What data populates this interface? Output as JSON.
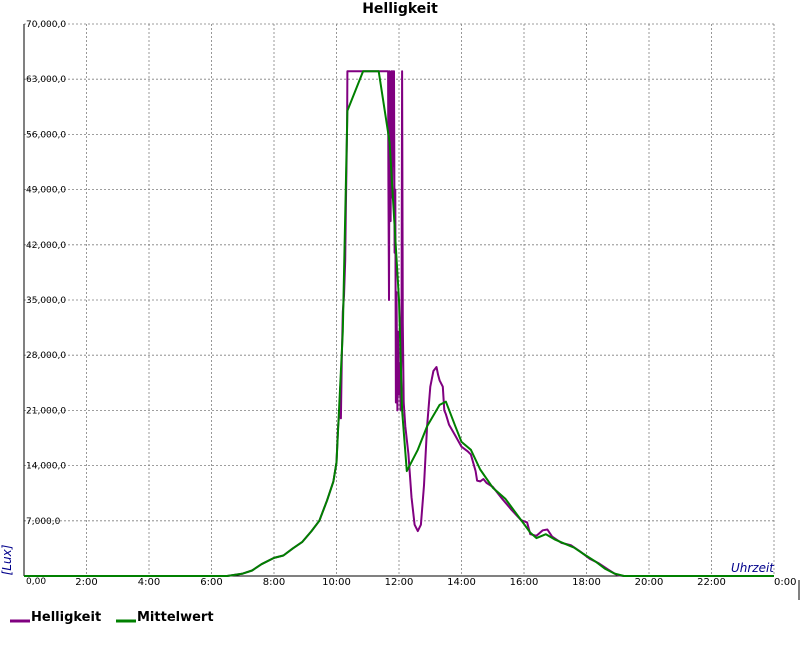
{
  "chart_data": {
    "type": "line",
    "title": "Helligkeit",
    "xlabel": "Uhrzeit",
    "ylabel": "[Lux]",
    "xlim": [
      0,
      24
    ],
    "ylim": [
      0,
      70000
    ],
    "grid": true,
    "legend_position": "bottom-left",
    "y_ticks": [
      {
        "value": 0,
        "label": "0,00"
      },
      {
        "value": 7000,
        "label": "7,000,0"
      },
      {
        "value": 14000,
        "label": "14,000,0"
      },
      {
        "value": 21000,
        "label": "21,000,0"
      },
      {
        "value": 28000,
        "label": "28,000,0"
      },
      {
        "value": 35000,
        "label": "35,000,0"
      },
      {
        "value": 42000,
        "label": "42,000,0"
      },
      {
        "value": 49000,
        "label": "49,000,0"
      },
      {
        "value": 56000,
        "label": "56,000,0"
      },
      {
        "value": 63000,
        "label": "63,000,0"
      },
      {
        "value": 70000,
        "label": "70,000,0"
      }
    ],
    "x_ticks": [
      {
        "value": 2,
        "label": "2:00"
      },
      {
        "value": 4,
        "label": "4:00"
      },
      {
        "value": 6,
        "label": "6:00"
      },
      {
        "value": 8,
        "label": "8:00"
      },
      {
        "value": 10,
        "label": "10:00"
      },
      {
        "value": 12,
        "label": "12:00"
      },
      {
        "value": 14,
        "label": "14:00"
      },
      {
        "value": 16,
        "label": "16:00"
      },
      {
        "value": 18,
        "label": "18:00"
      },
      {
        "value": 20,
        "label": "20:00"
      },
      {
        "value": 22,
        "label": "22:00"
      },
      {
        "value": 24,
        "label": "0:00"
      }
    ],
    "series": [
      {
        "name": "Helligkeit",
        "color": "#800080",
        "points": [
          [
            0,
            0
          ],
          [
            6.5,
            0
          ],
          [
            7.0,
            300
          ],
          [
            7.3,
            700
          ],
          [
            7.6,
            1500
          ],
          [
            8.0,
            2300
          ],
          [
            8.3,
            2600
          ],
          [
            8.6,
            3500
          ],
          [
            8.9,
            4300
          ],
          [
            9.2,
            5700
          ],
          [
            9.45,
            7000
          ],
          [
            9.7,
            9600
          ],
          [
            9.9,
            12000
          ],
          [
            10.0,
            14400
          ],
          [
            10.05,
            19000
          ],
          [
            10.1,
            21000
          ],
          [
            10.12,
            24000
          ],
          [
            10.14,
            20000
          ],
          [
            10.17,
            27500
          ],
          [
            10.2,
            33500
          ],
          [
            10.24,
            35500
          ],
          [
            10.28,
            40000
          ],
          [
            10.3,
            47000
          ],
          [
            10.32,
            52000
          ],
          [
            10.34,
            57000
          ],
          [
            10.35,
            64000
          ],
          [
            11.65,
            64000
          ],
          [
            11.66,
            50000
          ],
          [
            11.68,
            35000
          ],
          [
            11.7,
            64000
          ],
          [
            11.73,
            45000
          ],
          [
            11.76,
            64000
          ],
          [
            11.78,
            48000
          ],
          [
            11.8,
            64000
          ],
          [
            11.82,
            52000
          ],
          [
            11.84,
            64000
          ],
          [
            11.86,
            41000
          ],
          [
            11.88,
            49000
          ],
          [
            11.9,
            22000
          ],
          [
            11.92,
            36000
          ],
          [
            11.95,
            21000
          ],
          [
            11.97,
            31000
          ],
          [
            12.0,
            23000
          ],
          [
            12.03,
            27000
          ],
          [
            12.05,
            21000
          ],
          [
            12.08,
            30000
          ],
          [
            12.1,
            64000
          ],
          [
            12.12,
            32000
          ],
          [
            12.15,
            22000
          ],
          [
            12.2,
            19000
          ],
          [
            12.3,
            15500
          ],
          [
            12.4,
            10000
          ],
          [
            12.5,
            6500
          ],
          [
            12.6,
            5700
          ],
          [
            12.7,
            6500
          ],
          [
            12.8,
            11500
          ],
          [
            12.9,
            19000
          ],
          [
            13.0,
            24000
          ],
          [
            13.1,
            26000
          ],
          [
            13.2,
            26500
          ],
          [
            13.25,
            25500
          ],
          [
            13.3,
            24800
          ],
          [
            13.4,
            24000
          ],
          [
            13.45,
            21000
          ],
          [
            13.5,
            20500
          ],
          [
            13.6,
            19200
          ],
          [
            13.8,
            17800
          ],
          [
            14.0,
            16400
          ],
          [
            14.2,
            15800
          ],
          [
            14.3,
            15400
          ],
          [
            14.45,
            13300
          ],
          [
            14.5,
            12100
          ],
          [
            14.6,
            12000
          ],
          [
            14.7,
            12300
          ],
          [
            14.8,
            11800
          ],
          [
            15.0,
            11300
          ],
          [
            15.3,
            9800
          ],
          [
            15.6,
            8400
          ],
          [
            15.9,
            7100
          ],
          [
            16.1,
            6800
          ],
          [
            16.2,
            5300
          ],
          [
            16.4,
            5100
          ],
          [
            16.6,
            5800
          ],
          [
            16.75,
            5900
          ],
          [
            16.9,
            5000
          ],
          [
            17.2,
            4200
          ],
          [
            17.5,
            3900
          ],
          [
            17.8,
            3100
          ],
          [
            18.1,
            2200
          ],
          [
            18.4,
            1600
          ],
          [
            18.7,
            800
          ],
          [
            18.9,
            300
          ],
          [
            19.0,
            100
          ],
          [
            19.2,
            0
          ],
          [
            24.0,
            0
          ]
        ]
      },
      {
        "name": "Mittelwert",
        "color": "#008000",
        "points": [
          [
            0,
            0
          ],
          [
            6.5,
            0
          ],
          [
            7.0,
            300
          ],
          [
            7.3,
            700
          ],
          [
            7.6,
            1500
          ],
          [
            8.0,
            2300
          ],
          [
            8.3,
            2600
          ],
          [
            8.6,
            3500
          ],
          [
            8.9,
            4300
          ],
          [
            9.2,
            5700
          ],
          [
            9.45,
            7000
          ],
          [
            9.7,
            9600
          ],
          [
            9.9,
            12000
          ],
          [
            10.0,
            14400
          ],
          [
            10.2,
            31000
          ],
          [
            10.35,
            59000
          ],
          [
            10.85,
            64000
          ],
          [
            11.35,
            64000
          ],
          [
            11.7,
            55000
          ],
          [
            12.0,
            35000
          ],
          [
            12.1,
            21000
          ],
          [
            12.25,
            13300
          ],
          [
            12.6,
            16000
          ],
          [
            12.9,
            19000
          ],
          [
            13.3,
            21700
          ],
          [
            13.5,
            22100
          ],
          [
            13.8,
            19000
          ],
          [
            14.0,
            17000
          ],
          [
            14.3,
            16000
          ],
          [
            14.6,
            13500
          ],
          [
            15.0,
            11200
          ],
          [
            15.4,
            9800
          ],
          [
            15.7,
            8200
          ],
          [
            16.0,
            6600
          ],
          [
            16.2,
            5500
          ],
          [
            16.4,
            4800
          ],
          [
            16.7,
            5300
          ],
          [
            17.0,
            4600
          ],
          [
            17.3,
            4100
          ],
          [
            17.6,
            3600
          ],
          [
            17.9,
            2800
          ],
          [
            18.3,
            1800
          ],
          [
            18.6,
            900
          ],
          [
            18.9,
            300
          ],
          [
            19.2,
            0
          ],
          [
            24.0,
            0
          ]
        ]
      }
    ]
  }
}
